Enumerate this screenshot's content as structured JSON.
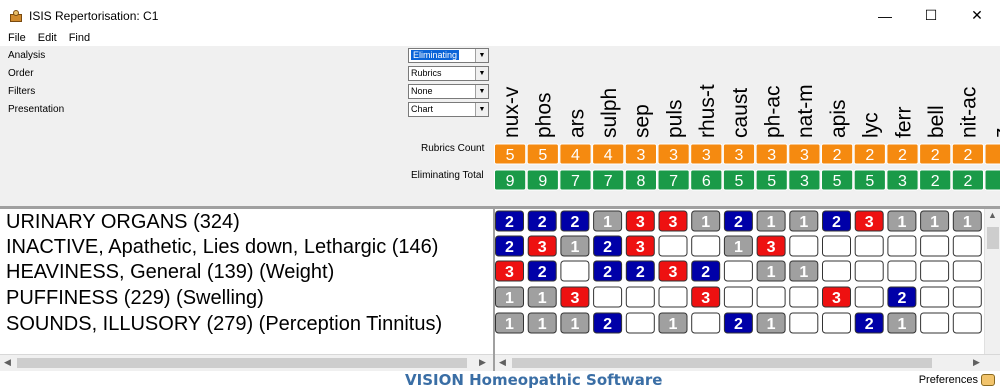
{
  "window": {
    "title": "ISIS Repertorisation: C1",
    "controls": {
      "minimize": "—",
      "maximize": "☐",
      "close": "✕"
    }
  },
  "menu": [
    "File",
    "Edit",
    "Find"
  ],
  "options": [
    {
      "label": "Analysis",
      "value": "Eliminating",
      "selected": true
    },
    {
      "label": "Order",
      "value": "Rubrics",
      "selected": false
    },
    {
      "label": "Filters",
      "value": "None",
      "selected": false
    },
    {
      "label": "Presentation",
      "value": "Chart",
      "selected": false
    }
  ],
  "row_labels": {
    "rubrics_count": "Rubrics Count",
    "eliminating_total": "Eliminating Total"
  },
  "remedies": [
    "nux-v",
    "phos",
    "ars",
    "sulph",
    "sep",
    "puls",
    "rhus-t",
    "caust",
    "ph-ac",
    "nat-m",
    "apis",
    "lyc",
    "ferr",
    "bell",
    "nit-ac",
    "z"
  ],
  "rubrics_count": [
    "5",
    "5",
    "4",
    "4",
    "3",
    "3",
    "3",
    "3",
    "3",
    "3",
    "2",
    "2",
    "2",
    "2",
    "2",
    ""
  ],
  "eliminating_total": [
    "9",
    "9",
    "7",
    "7",
    "8",
    "7",
    "6",
    "5",
    "5",
    "3",
    "5",
    "5",
    "3",
    "2",
    "2",
    ""
  ],
  "rubrics": [
    "URINARY ORGANS (324)",
    "INACTIVE, Apathetic, Lies down, Lethargic (146)",
    "HEAVINESS, General (139) (Weight)",
    "PUFFINESS (229) (Swelling)",
    "SOUNDS, ILLUSORY (279) (Perception Tinnitus)"
  ],
  "grades": [
    [
      "2",
      "2",
      "2",
      "1",
      "3",
      "3",
      "1",
      "2",
      "1",
      "1",
      "2",
      "3",
      "1",
      "1",
      "1",
      ""
    ],
    [
      "2",
      "3",
      "1",
      "2",
      "3",
      "",
      "",
      "1",
      "3",
      "",
      "",
      "",
      "",
      "",
      "",
      ""
    ],
    [
      "3",
      "2",
      "",
      "2",
      "2",
      "3",
      "2",
      "",
      "1",
      "1",
      "",
      "",
      "",
      "",
      "",
      ""
    ],
    [
      "1",
      "1",
      "3",
      "",
      "",
      "",
      "3",
      "",
      "",
      "",
      "3",
      "",
      "2",
      "",
      "",
      ""
    ],
    [
      "1",
      "1",
      "1",
      "2",
      "",
      "1",
      "",
      "2",
      "1",
      "",
      "",
      "2",
      "1",
      "",
      "",
      ""
    ]
  ],
  "colors": {
    "grade1": "#a0a0a0",
    "grade2": "#0000a8",
    "grade3": "#ee1111",
    "count": "#f58a10",
    "total": "#1a9a48",
    "brand": "#3a6ea5"
  },
  "footer": {
    "brand": "VISION Homeopathic Software",
    "preferences": "Preferences"
  },
  "icons": {
    "app": "app-icon",
    "prefs": "preferences-icon"
  }
}
